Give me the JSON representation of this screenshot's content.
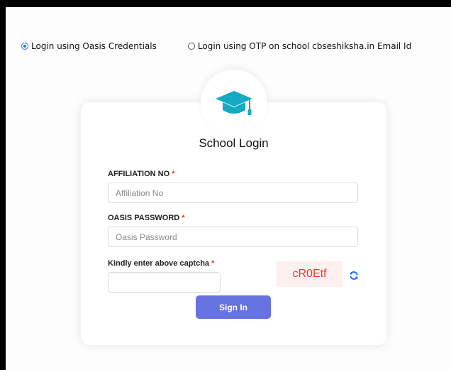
{
  "login_options": [
    {
      "label": "Login using Oasis Credentials",
      "selected": true
    },
    {
      "label": "Login using OTP on school cbseshiksha.in Email Id",
      "selected": false
    }
  ],
  "card": {
    "logo_icon": "graduation-cap-icon",
    "title": "School Login",
    "affiliation": {
      "label": "AFFILIATION NO",
      "required_mark": "*",
      "placeholder": "Affiliation No",
      "value": ""
    },
    "password": {
      "label": "OASIS PASSWORD",
      "required_mark": "*",
      "placeholder": "Oasis Password",
      "value": ""
    },
    "captcha": {
      "label": "Kindly enter above captcha",
      "required_mark": "*",
      "placeholder": "",
      "value": "",
      "code": "cR0Etf",
      "refresh_icon": "refresh-icon"
    },
    "signin_label": "Sign In"
  },
  "colors": {
    "accent": "#1a73e8",
    "logo": "#16a9c4",
    "button": "#6672e0",
    "required": "#e53935",
    "captcha_bg": "#fdf0ee",
    "captcha_text": "#e53935"
  }
}
